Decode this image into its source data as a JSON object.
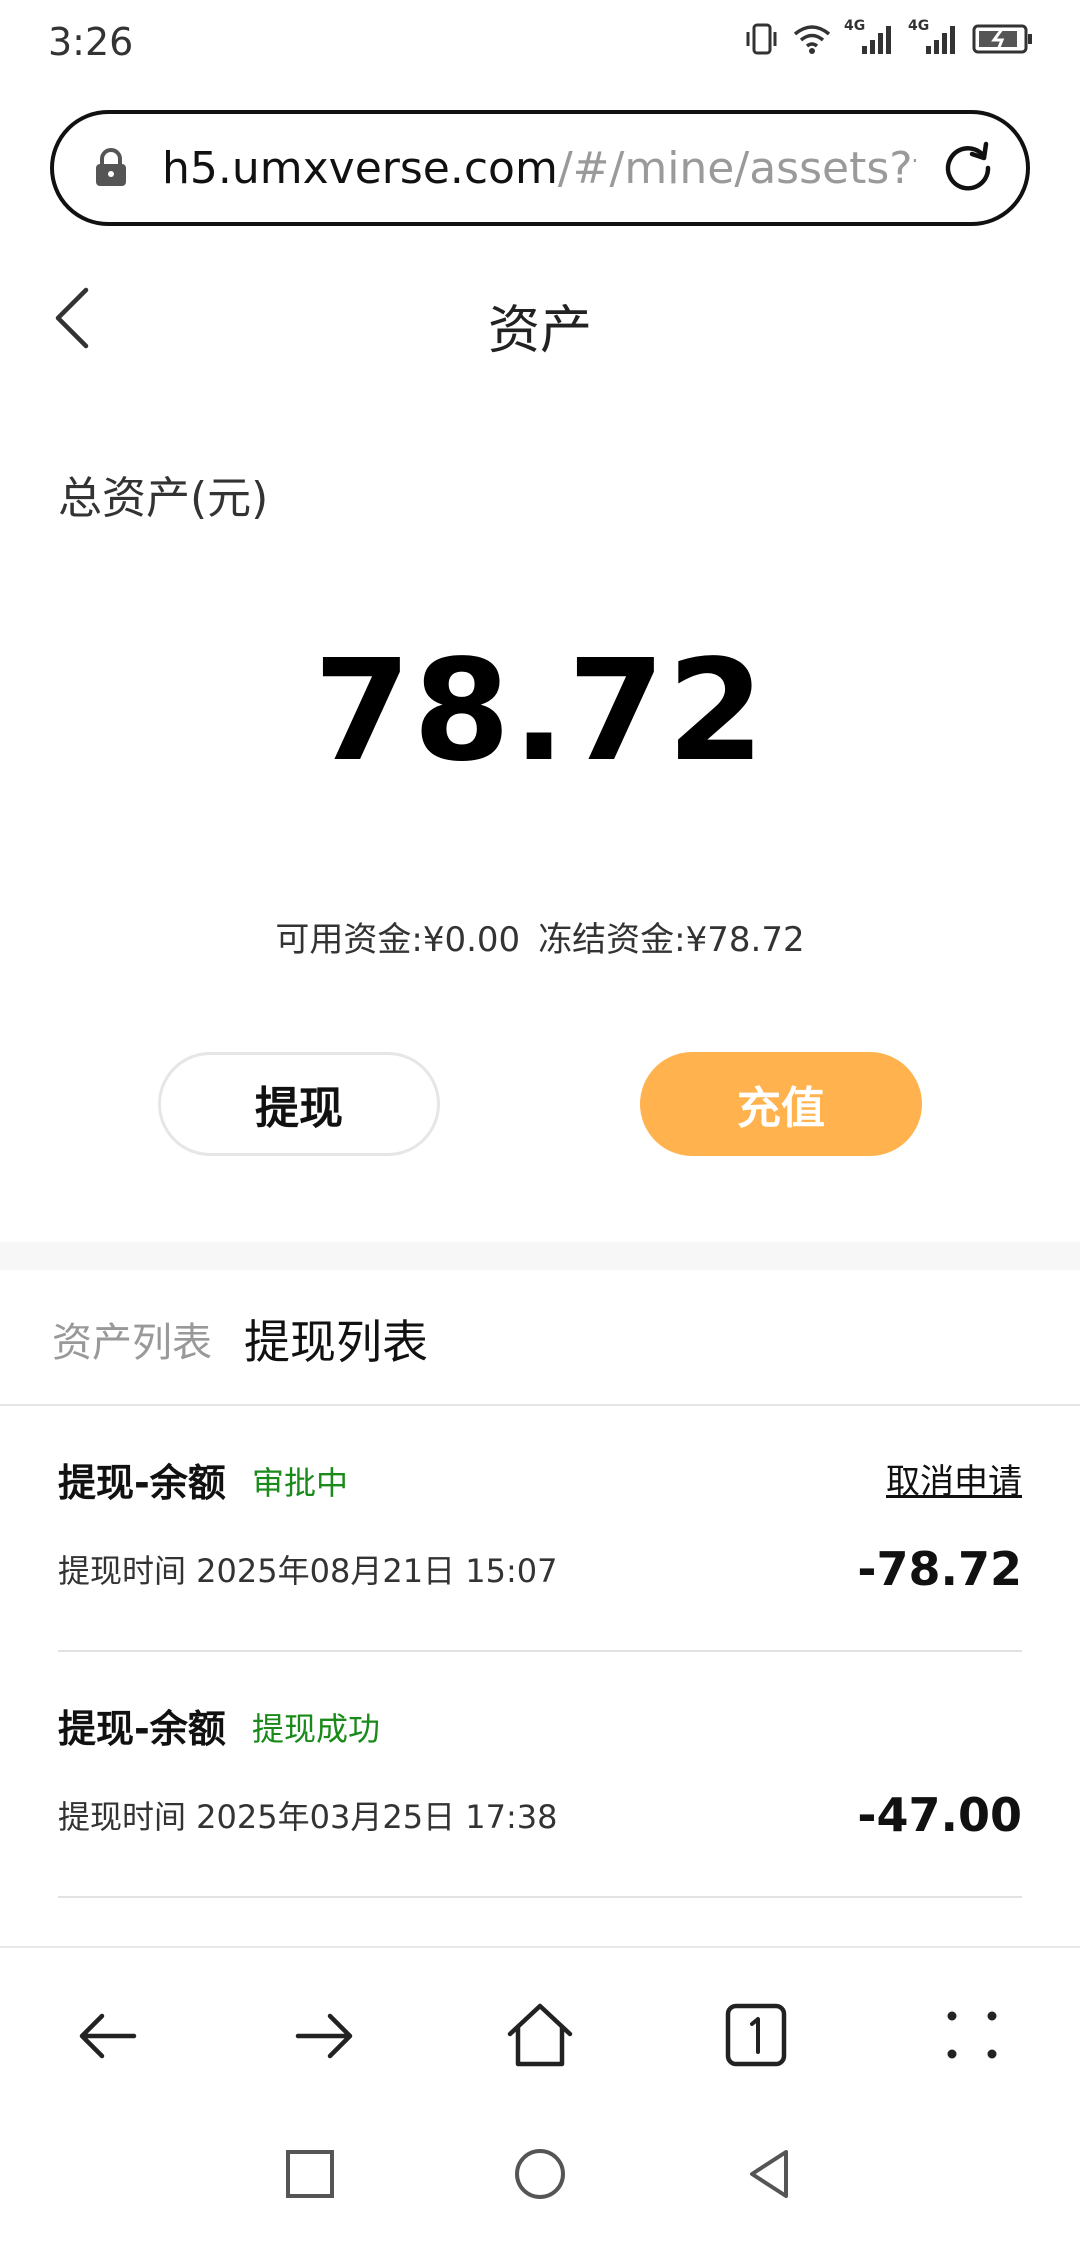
{
  "status_bar": {
    "time": "3:26",
    "signal1_label": "4G",
    "signal2_label": "4G"
  },
  "browser": {
    "url_host": "h5.umxverse.com",
    "url_path": "/#/mine/assets?t"
  },
  "header": {
    "title": "资产"
  },
  "assets": {
    "total_label": "总资产(元)",
    "total_amount": "78.72",
    "available": "可用资金:¥0.00",
    "frozen": "冻结资金:¥78.72",
    "withdraw_label": "提现",
    "recharge_label": "充值"
  },
  "tabs": {
    "assets_list": "资产列表",
    "withdraw_list": "提现列表"
  },
  "records": [
    {
      "title": "提现-余额",
      "status": "审批中",
      "action": "取消申请",
      "time": "提现时间 2025年08月21日 15:07",
      "amount": "-78.72"
    },
    {
      "title": "提现-余额",
      "status": "提现成功",
      "time": "提现时间 2025年03月25日 17:38",
      "amount": "-47.00"
    }
  ],
  "colors": {
    "accent": "#ffb24d",
    "status_green": "#1a8a1a"
  }
}
